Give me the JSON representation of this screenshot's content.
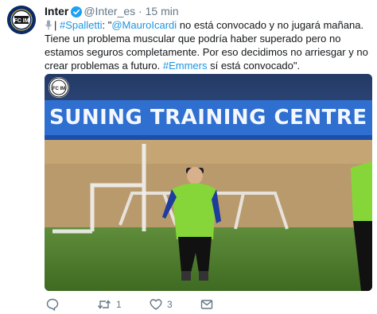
{
  "tweet": {
    "author_name": "Inter",
    "handle": "@Inter_es",
    "separator": "·",
    "time": "15 min",
    "text": {
      "hashtag_spalletti": "#Spalletti",
      "part1": ": \"",
      "mention": "@MauroIcardi",
      "part2": " no está convocado y no jugará mañana. Tiene un problema muscular que podría haber superado pero no estamos seguros completamente. Por eso decidimos no arriesgar y no crear problemas a futuro. ",
      "hashtag_emmers": "#Emmers",
      "part3": " sí está convocado\"."
    },
    "media": {
      "banner_text": "SUNING TRAINING CENTRE",
      "photo_logo_text": "FC IM"
    },
    "actions": {
      "reply_count": "",
      "retweet_count": "1",
      "like_count": "3"
    }
  },
  "colors": {
    "link": "#1b95e0",
    "verified": "#1da1f2",
    "inter_blue": "#0a2a66",
    "muted": "#657786"
  },
  "icons": [
    "avatar-logo",
    "verified-badge-icon",
    "microphone-icon",
    "reply-icon",
    "retweet-icon",
    "like-icon",
    "message-icon"
  ]
}
